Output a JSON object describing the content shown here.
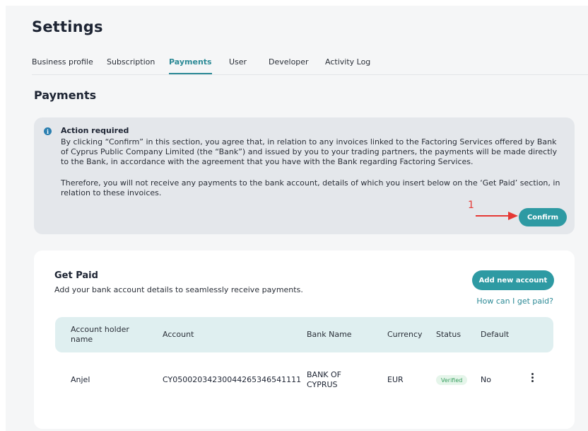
{
  "page": {
    "title": "Settings"
  },
  "tabs": [
    {
      "label": "Business profile"
    },
    {
      "label": "Subscription"
    },
    {
      "label": "Payments"
    },
    {
      "label": "User"
    },
    {
      "label": "Developer"
    },
    {
      "label": "Activity Log"
    }
  ],
  "active_tab": "Payments",
  "payments": {
    "section_title": "Payments",
    "alert": {
      "icon": "info-icon",
      "heading": "Action required",
      "paragraph1": "By clicking “Confirm” in this section, you agree that, in relation to any invoices linked to the Factoring Services offered by Bank of Cyprus Public Company Limited (the “Bank”) and issued by you to your trading partners, the payments will be made directly to the Bank, in accordance with the agreement that you have with the Bank regarding Factoring Services.",
      "paragraph2": "Therefore, you will not receive any payments to the bank account, details of which you insert below on the ‘Get Paid’ section, in relation to these invoices.",
      "confirm_label": "Confirm"
    },
    "annotation": {
      "number": "1",
      "color": "#e53935"
    }
  },
  "get_paid": {
    "title": "Get Paid",
    "subtitle": "Add your bank account details to seamlessly receive payments.",
    "add_button": "Add new account",
    "help_link": "How can I get paid?",
    "columns": [
      "Account holder name",
      "Account",
      "Bank Name",
      "Currency",
      "Status",
      "Default"
    ],
    "rows": [
      {
        "holder": "Anjel",
        "account": "CY05002034230044265346541111",
        "bank": "BANK OF CYPRUS",
        "currency": "EUR",
        "status": "Verified",
        "default": "No"
      }
    ]
  },
  "colors": {
    "accent": "#2e9aa3",
    "alert_bg": "#e4e7eb",
    "verified": "#3aa060"
  }
}
